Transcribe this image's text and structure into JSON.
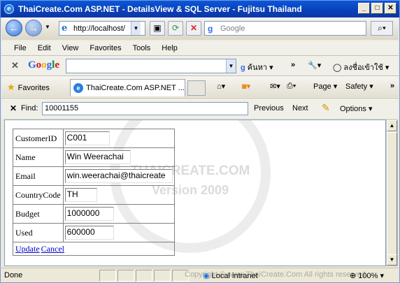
{
  "window": {
    "title": "ThaiCreate.Com ASP.NET - DetailsView & SQL Server - Fujitsu Thailand",
    "buttons": [
      "_",
      "□",
      "✕"
    ]
  },
  "nav": {
    "address": "http://localhost/",
    "search_placeholder": "Google"
  },
  "menu": [
    "File",
    "Edit",
    "View",
    "Favorites",
    "Tools",
    "Help"
  ],
  "google_toolbar": {
    "logo": "Google",
    "search_button": "ค้นหา",
    "more": "»",
    "signin": "ลงชื่อเข้าใช้"
  },
  "favorites_bar": {
    "favorites_label": "Favorites",
    "tab_title": "ThaiCreate.Com ASP.NET ...",
    "page": "Page",
    "safety": "Safety",
    "more": "»"
  },
  "find": {
    "label": "Find:",
    "value": "10001155",
    "previous": "Previous",
    "next": "Next",
    "options": "Options"
  },
  "watermark": {
    "line1": "THAICREATE.COM",
    "line2": "Version 2009"
  },
  "details": {
    "rows": [
      {
        "label": "CustomerID",
        "value": "C001"
      },
      {
        "label": "Name",
        "value": "Win Weerachai"
      },
      {
        "label": "Email",
        "value": "win.weerachai@thaicreate"
      },
      {
        "label": "CountryCode",
        "value": "TH"
      },
      {
        "label": "Budget",
        "value": "1000000"
      },
      {
        "label": "Used",
        "value": "600000"
      }
    ],
    "update": "Update",
    "cancel": "Cancel"
  },
  "status": {
    "text": "Done",
    "zone": "Local intranet",
    "zoom": "100%",
    "copyright": "Copyright © www.ThaiCreate.Com All rights reserved."
  }
}
